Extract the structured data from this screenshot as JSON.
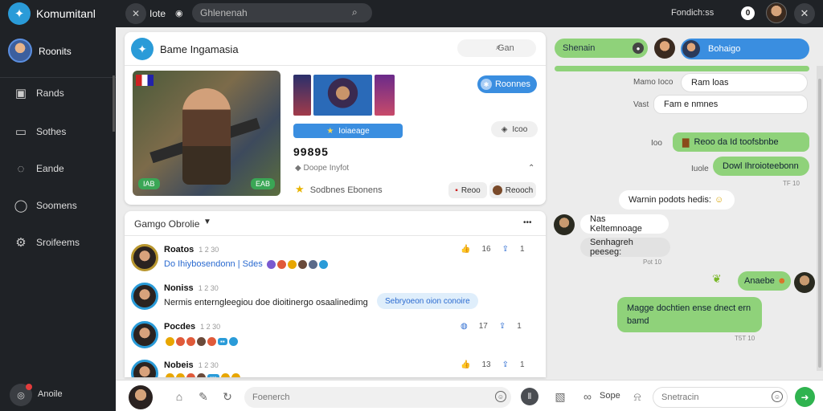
{
  "topbar": {
    "app_name": "Komumitanl",
    "label": "Iote",
    "search_placeholder": "Ghlenenah",
    "status": "Fondich:ss",
    "badge": "0"
  },
  "sidebar": {
    "user": "Roonits",
    "items": [
      {
        "label": "Rands",
        "icon": "monitor-icon"
      },
      {
        "label": "Sothes",
        "icon": "tv-icon"
      },
      {
        "label": "Eande",
        "icon": "chat-bubble-icon"
      },
      {
        "label": "Soomens",
        "icon": "comment-icon"
      },
      {
        "label": "Sroifeems",
        "icon": "gear-icon"
      }
    ],
    "bottom_label": "Anoile"
  },
  "game_card": {
    "title": "Bame Ingamasia",
    "search_label": "Gan",
    "primary_button": "Ioiaeage",
    "number": "99895",
    "meta": "Doope Inyfot",
    "rating_text": "Sodbnes Ebonens",
    "follow_button": "Roonnes",
    "info_button": "Icoo",
    "pill_a": "Reoo",
    "pill_b": "Reooch",
    "hero_tag_left": "IAB",
    "hero_tag_right": "EAB"
  },
  "feed": {
    "title": "Gamgo Obrolie",
    "rows": [
      {
        "name": "Roatos",
        "time": "1 2 30",
        "text": "Do Ihiybosendonn | Sdes",
        "text_style": "link",
        "chip": "",
        "stat_a": "16",
        "stat_b": "1"
      },
      {
        "name": "Noniss",
        "time": "1 2 30",
        "text": "Nermis enterngleegiou doe dioitinergo osaalinedimg",
        "text_style": "dark",
        "chip": "Sebryoeon oion conoire",
        "stat_a": "",
        "stat_b": ""
      },
      {
        "name": "Pocdes",
        "time": "1 2 30",
        "text": "",
        "text_style": "link",
        "chip": "",
        "stat_a": "17",
        "stat_b": "1"
      },
      {
        "name": "Nobeis",
        "time": "1 2 30",
        "text": "",
        "text_style": "link",
        "chip": "",
        "stat_a": "13",
        "stat_b": "1"
      }
    ]
  },
  "composer": {
    "placeholder": "Foenerch",
    "label": "Sope",
    "placeholder2": "Snetracin"
  },
  "chat": {
    "green_pill": "Shenain",
    "blue_pill": "Bohaigo",
    "messages": [
      {
        "label": "Mamo Ioco",
        "text": "Ram loas"
      },
      {
        "label": "Vast",
        "text": "Fam e nmnes"
      },
      {
        "label": "Ioo",
        "text": "Reoo da Id toofsbnbe"
      },
      {
        "label": "Iuole",
        "text": "Dowl Ihroioteebonn"
      },
      {
        "label": "",
        "text": "Warnin podots hedis:"
      },
      {
        "label": "",
        "text": "Nas Keltemnoage"
      },
      {
        "label": "",
        "text": "Senhagreh peeseg:"
      },
      {
        "label": "",
        "text": "Anaebe"
      },
      {
        "label": "",
        "text": "Magge dochtien ense dnect ern bamd"
      }
    ],
    "timestamps": [
      "TF 10",
      "Pot 10",
      "T5T 10"
    ]
  }
}
